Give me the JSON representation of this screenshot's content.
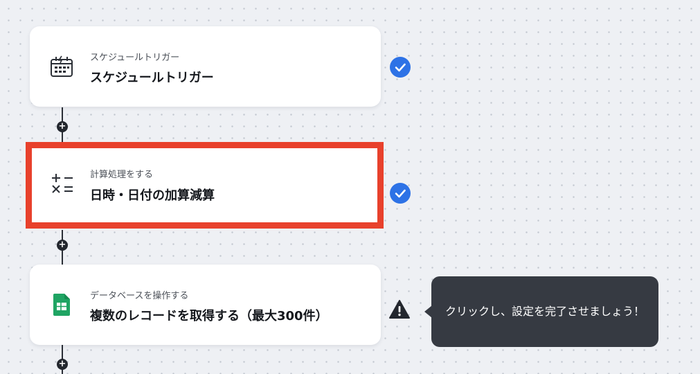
{
  "flow": {
    "steps": [
      {
        "subtitle": "スケジュールトリガー",
        "title": "スケジュールトリガー",
        "icon": "schedule-calendar-icon",
        "status": "complete"
      },
      {
        "subtitle": "計算処理をする",
        "title": "日時・日付の加算減算",
        "icon": "calculator-operators-icon",
        "status": "complete"
      },
      {
        "subtitle": "データベースを操作する",
        "title": "複数のレコードを取得する（最大300件）",
        "icon": "google-sheets-icon",
        "status": "incomplete"
      }
    ],
    "tooltip": "クリックし、設定を完了させましょう！",
    "add_step_symbol": "+"
  },
  "colors": {
    "background": "#eef0f4",
    "complete_badge": "#2d72e6",
    "highlight_border": "#e8412c",
    "tooltip_bg": "#363a42",
    "sheets_green": "#1fa463"
  }
}
